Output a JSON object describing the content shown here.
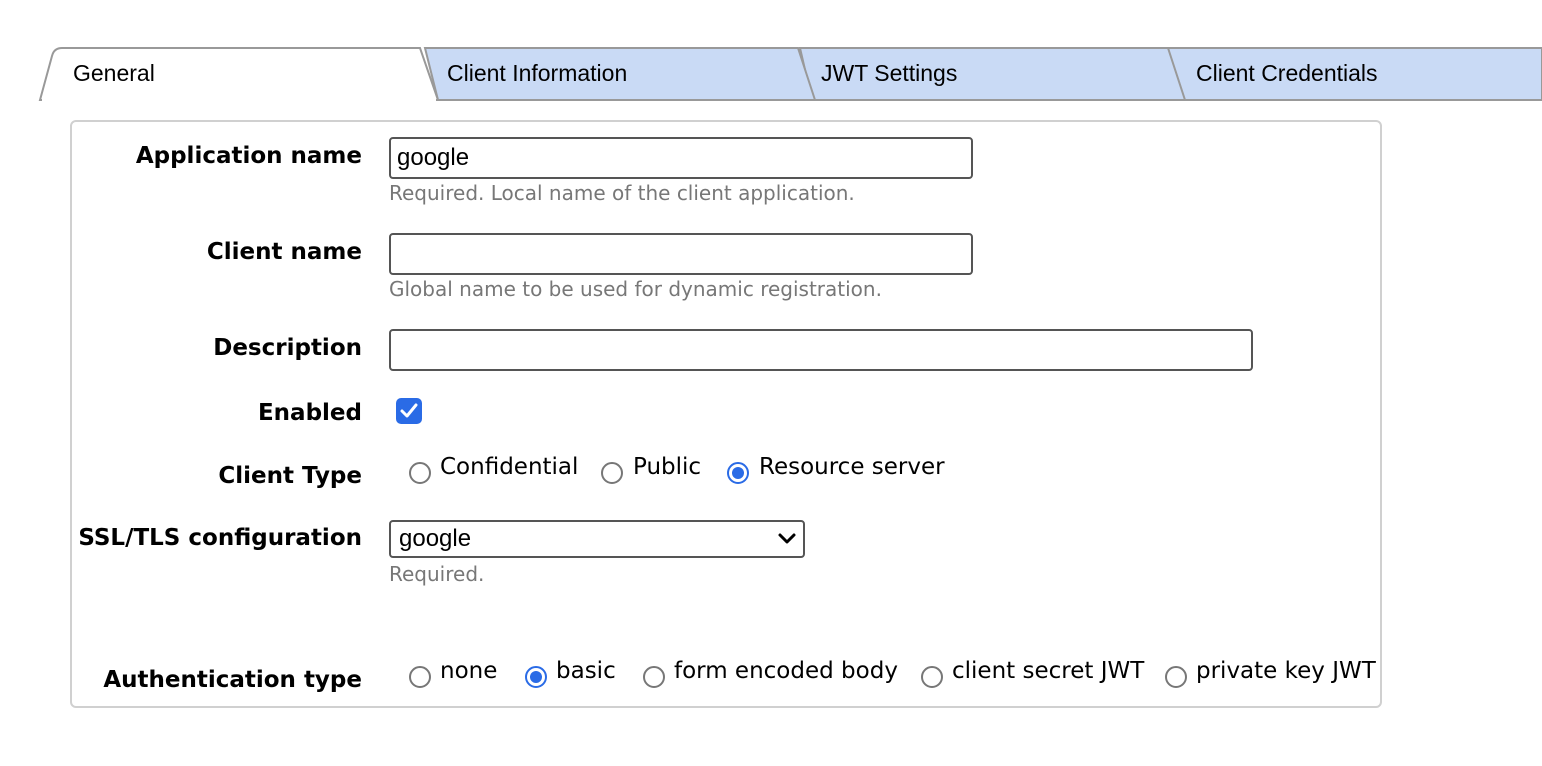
{
  "tabs": [
    {
      "label": "General",
      "active": true
    },
    {
      "label": "Client Information",
      "active": false
    },
    {
      "label": "JWT Settings",
      "active": false
    },
    {
      "label": "Client Credentials",
      "active": false
    }
  ],
  "colors": {
    "tab_active": "#ffffff",
    "tab_inactive": "#c9daf5",
    "accent": "#2a6be6"
  },
  "form": {
    "application_name": {
      "label": "Application name",
      "value": "google",
      "hint": "Required. Local name of the client application."
    },
    "client_name": {
      "label": "Client name",
      "value": "",
      "hint": "Global name to be used for dynamic registration."
    },
    "description": {
      "label": "Description",
      "value": ""
    },
    "enabled": {
      "label": "Enabled",
      "checked": true
    },
    "client_type": {
      "label": "Client Type",
      "options": [
        "Confidential",
        "Public",
        "Resource server"
      ],
      "selected": "Resource server"
    },
    "ssl_tls": {
      "label": "SSL/TLS configuration",
      "value": "google",
      "hint": "Required."
    },
    "auth_type": {
      "label": "Authentication type",
      "options": [
        "none",
        "basic",
        "form encoded body",
        "client secret JWT",
        "private key JWT"
      ],
      "selected": "basic"
    }
  }
}
